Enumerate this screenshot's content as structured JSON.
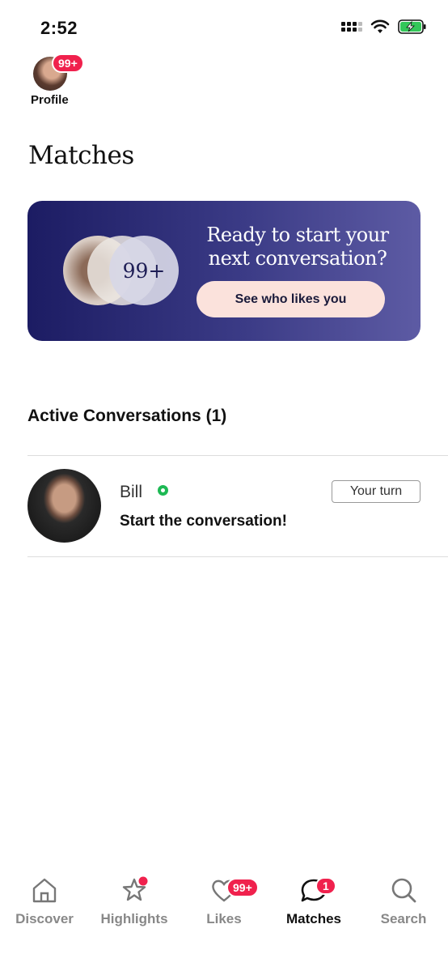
{
  "status_bar": {
    "time": "2:52"
  },
  "profile": {
    "label": "Profile",
    "badge": "99+"
  },
  "page": {
    "title": "Matches"
  },
  "promo": {
    "count": "99+",
    "headline_line1": "Ready to start your",
    "headline_line2": "next conversation?",
    "button_label": "See who likes you"
  },
  "conversations": {
    "section_title": "Active Conversations (1)",
    "items": [
      {
        "name": "Bill",
        "message": "Start the conversation!",
        "status_tag": "Your turn",
        "online": true
      }
    ]
  },
  "nav": {
    "items": [
      {
        "label": "Discover",
        "icon": "home-icon"
      },
      {
        "label": "Highlights",
        "icon": "star-icon"
      },
      {
        "label": "Likes",
        "icon": "heart-icon",
        "badge": "99+"
      },
      {
        "label": "Matches",
        "icon": "chat-bubble-icon",
        "badge": "1"
      },
      {
        "label": "Search",
        "icon": "search-icon"
      }
    ]
  },
  "colors": {
    "accent_red": "#f0214d",
    "promo_dark": "#1c1c63",
    "online_green": "#1db954",
    "button_peach": "#fbe2dc"
  }
}
